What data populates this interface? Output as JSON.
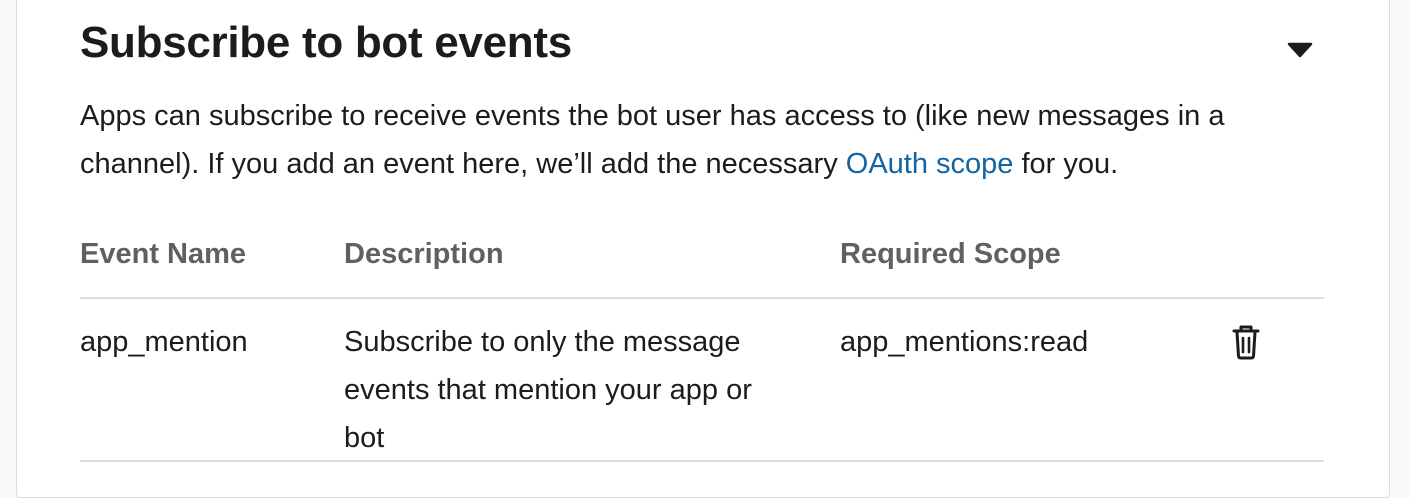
{
  "section": {
    "title": "Subscribe to bot events",
    "toggle_icon": "caret-down-icon"
  },
  "description": {
    "text_before": "Apps can subscribe to receive events the bot user has access to (like new messages in a channel). If you add an event here, we’ll add the necessary ",
    "link_text": "OAuth scope",
    "text_after": " for you."
  },
  "table": {
    "headers": {
      "event_name": "Event Name",
      "description": "Description",
      "required_scope": "Required Scope"
    },
    "rows": [
      {
        "event_name": "app_mention",
        "description": "Subscribe to only the message events that mention your app or bot",
        "required_scope": "app_mentions:read",
        "action_icon": "trash-icon"
      }
    ]
  },
  "colors": {
    "link": "#1264a3",
    "text": "#1d1c1d",
    "header_text": "#616061",
    "divider": "#dddddd"
  }
}
